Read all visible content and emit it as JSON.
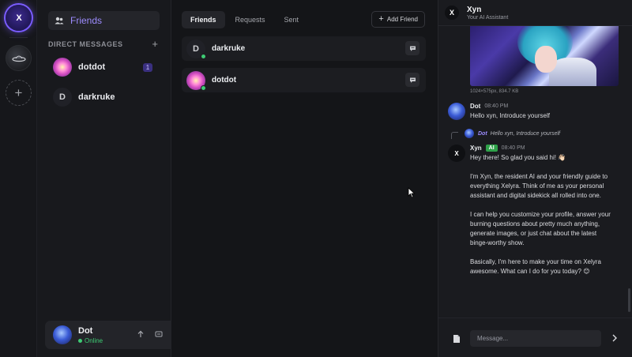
{
  "rail": {
    "home_label": "X",
    "add_label": "+"
  },
  "sidebar": {
    "friends_label": "Friends",
    "dm_header": "DIRECT MESSAGES",
    "dm_add": "+",
    "dms": [
      {
        "name": "dotdot",
        "unread": "1",
        "avatar_letter": ""
      },
      {
        "name": "darkruke",
        "unread": "",
        "avatar_letter": "D"
      }
    ]
  },
  "user": {
    "name": "Dot",
    "status": "Online"
  },
  "main": {
    "tabs": [
      {
        "label": "Friends",
        "active": true
      },
      {
        "label": "Requests",
        "active": false
      },
      {
        "label": "Sent",
        "active": false
      }
    ],
    "add_friend_label": "Add Friend",
    "friends": [
      {
        "name": "darkruke",
        "avatar_letter": "D",
        "online": true
      },
      {
        "name": "dotdot",
        "avatar_letter": "",
        "online": true
      }
    ]
  },
  "chat": {
    "title": "Xyn",
    "subtitle": "Your AI Assistant",
    "logo_letter": "X",
    "image_meta": "1024×575px, 834.7 KB",
    "messages": [
      {
        "author": "Dot",
        "time": "08:40 PM",
        "text": "Hello xyn, Introduce yourself"
      },
      {
        "author": "Xyn",
        "tag": "AI",
        "time": "08:40 PM",
        "reply_to_author": "Dot",
        "reply_to_text": "Hello xyn, Introduce yourself",
        "paragraphs": [
          "Hey there! So glad you said hi! 👋🏻",
          "I'm Xyn, the resident AI and your friendly guide to everything Xelyra. Think of me as your personal assistant and digital sidekick all rolled into one.",
          "I can help you customize your profile, answer your burning questions about pretty much anything, generate images, or just chat about the latest binge-worthy show.",
          "Basically, I'm here to make your time on Xelyra awesome. What can I do for you today? 😊"
        ]
      }
    ],
    "composer_placeholder": "Message..."
  },
  "colors": {
    "accent": "#9d8cff",
    "online": "#3ecb74",
    "ai_tag": "#2fa24a",
    "background": "#141518"
  },
  "icons": {
    "friends": "users-icon",
    "message": "chat-bubble-icon",
    "upload": "upload-icon",
    "card": "card-icon",
    "settings": "gear-icon",
    "attach": "file-icon",
    "send": "chevron-right-icon"
  }
}
